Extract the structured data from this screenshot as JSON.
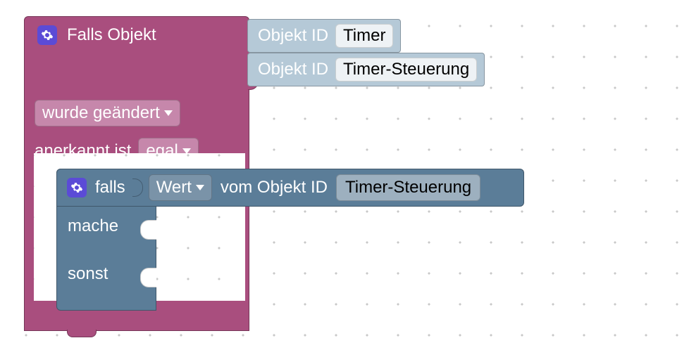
{
  "trigger": {
    "title": "Falls Objekt",
    "object_ids": [
      {
        "label": "Objekt ID",
        "value": "Timer"
      },
      {
        "label": "Objekt ID",
        "value": "Timer-Steuerung"
      }
    ],
    "condition_dropdown": "wurde geändert",
    "ack_label": "anerkannt ist",
    "ack_dropdown": "egal"
  },
  "if_block": {
    "if_label": "falls",
    "value_dropdown": "Wert",
    "from_label": "vom Objekt ID",
    "object_id_value": "Timer-Steuerung",
    "do_label": "mache",
    "else_label": "sonst"
  }
}
